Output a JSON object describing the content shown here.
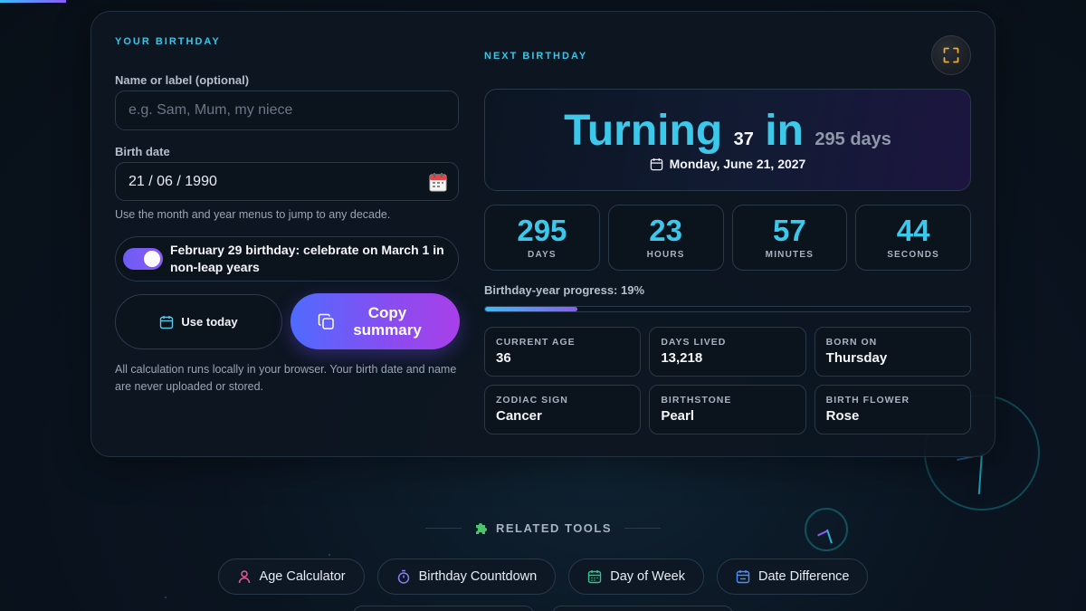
{
  "form": {
    "section_title": "YOUR BIRTHDAY",
    "name_label": "Name or label (optional)",
    "name_placeholder": "e.g. Sam, Mum, my niece",
    "name_value": "",
    "birth_label": "Birth date",
    "birth_value": "21 / 06 / 1990",
    "birth_hint": "Use the month and year menus to jump to any decade.",
    "leap_toggle_label": "February 29 birthday: celebrate on March 1 in non-leap years",
    "leap_toggle_on": true,
    "use_today_label": "Use today",
    "copy_summary_label": "Copy summary",
    "privacy_note": "All calculation runs locally in your browser. Your birth date and name are never uploaded or stored."
  },
  "result": {
    "section_title": "NEXT BIRTHDAY",
    "turning_word": "Turning",
    "turning_age": "37",
    "in_word": "in",
    "days_text": "295 days",
    "date_text": "Monday, June 21, 2027",
    "countdown": [
      {
        "value": "295",
        "label": "DAYS"
      },
      {
        "value": "23",
        "label": "HOURS"
      },
      {
        "value": "57",
        "label": "MINUTES"
      },
      {
        "value": "44",
        "label": "SECONDS"
      }
    ],
    "progress_label": "Birthday-year progress: 19%",
    "progress_percent": 19,
    "stats": [
      {
        "label": "CURRENT AGE",
        "value": "36"
      },
      {
        "label": "DAYS LIVED",
        "value": "13,218"
      },
      {
        "label": "BORN ON",
        "value": "Thursday"
      },
      {
        "label": "ZODIAC SIGN",
        "value": "Cancer"
      },
      {
        "label": "BIRTHSTONE",
        "value": "Pearl"
      },
      {
        "label": "BIRTH FLOWER",
        "value": "Rose"
      }
    ]
  },
  "related": {
    "title": "RELATED TOOLS",
    "tools": [
      {
        "label": "Age Calculator",
        "icon": "person-icon",
        "color": "#e25a9e"
      },
      {
        "label": "Birthday Countdown",
        "icon": "stopwatch-icon",
        "color": "#8b7cf6"
      },
      {
        "label": "Day of Week",
        "icon": "calendar-grid-icon",
        "color": "#34c48b"
      },
      {
        "label": "Date Difference",
        "icon": "calendar-diff-icon",
        "color": "#4f8ef7"
      }
    ]
  },
  "colors": {
    "accent": "#3cc8ea",
    "button_gradient_start": "#4f6bff",
    "button_gradient_end": "#a93fe9"
  }
}
